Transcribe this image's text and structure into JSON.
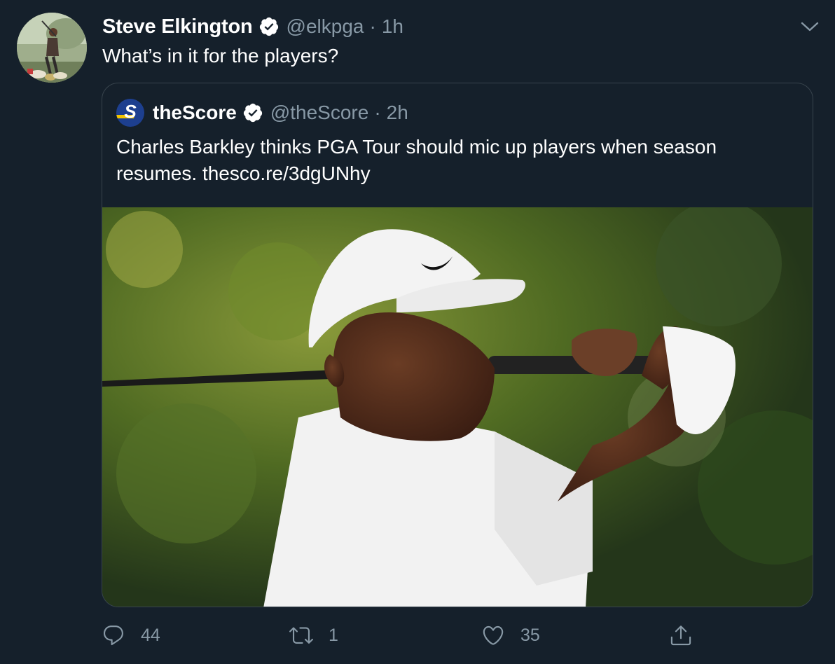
{
  "tweet": {
    "author": {
      "display_name": "Steve Elkington",
      "handle": "@elkpga",
      "verified": true,
      "avatar_icon": "golfer-avatar"
    },
    "separator": "·",
    "time": "1h",
    "text": "What’s in it for the players?",
    "menu_icon": "chevron-down-icon"
  },
  "quote": {
    "author": {
      "display_name": "theScore",
      "handle": "@theScore",
      "verified": true,
      "avatar_icon": "thescore-logo"
    },
    "separator": "·",
    "time": "2h",
    "text": "Charles Barkley thinks PGA Tour should mic up players when season resumes. thesco.re/3dgUNhy",
    "media": {
      "kind": "photo",
      "subject": "golfer-in-white-cap-and-shirt-mid-swing"
    }
  },
  "actions": {
    "reply_count": "44",
    "retweet_count": "1",
    "like_count": "35",
    "share_label": ""
  },
  "colors": {
    "background": "#15202b",
    "border": "#38444d",
    "secondary_text": "#8899a6",
    "primary_text": "#ffffff"
  }
}
